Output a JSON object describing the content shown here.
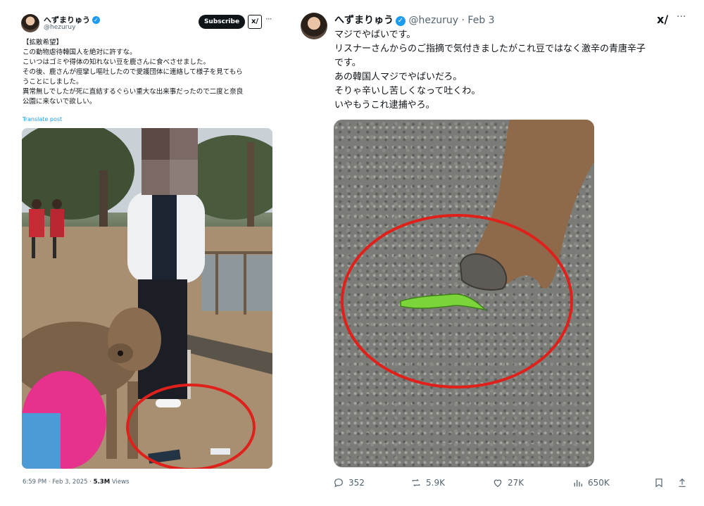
{
  "left_post": {
    "author_name": "へずまりゅう",
    "author_handle": "@hezuruy",
    "subscribe_label": "Subscribe",
    "grok_label": "x/",
    "more_label": "···",
    "text_lines": [
      "【拡散希望】",
      "この動物虐待韓国人を絶対に許すな。",
      "こいつはゴミや得体の知れない豆を鹿さんに食べさせました。",
      "その後、鹿さんが痙攣し嘔吐したので愛護団体に連絡して様子を見てもら",
      "うことにしました。",
      "異常無しでしたが死に直結するぐらい重大な出来事だったので二度と奈良",
      "公園に来ないで欲しい。"
    ],
    "translate_label": "Translate post",
    "meta_time": "6:59 PM · Feb 3, 2025 · ",
    "meta_views": "5.3M",
    "meta_views_label": " Views"
  },
  "right_post": {
    "author_name": "へずまりゅう",
    "author_handle": "@hezuruy",
    "date": "· Feb 3",
    "grok_label": "x/",
    "more_label": "···",
    "text_lines": [
      "マジでやばいです。",
      "リスナーさんからのご指摘で気付きましたがこれ豆ではなく激辛の青唐辛子",
      "です。",
      "あの韓国人マジでやばいだろ。",
      "そりゃ辛いし苦しくなって吐くわ。",
      "いやもうこれ逮捕やろ。"
    ],
    "actions": {
      "replies": "352",
      "reposts": "5.9K",
      "likes": "27K",
      "views": "650K"
    }
  },
  "colors": {
    "accent": "#1d9bf0",
    "annotation_circle": "#e0201b"
  },
  "icons": [
    "verified-badge-icon",
    "grok-icon",
    "more-icon",
    "reply-icon",
    "repost-icon",
    "like-icon",
    "views-icon",
    "bookmark-icon",
    "share-icon"
  ]
}
